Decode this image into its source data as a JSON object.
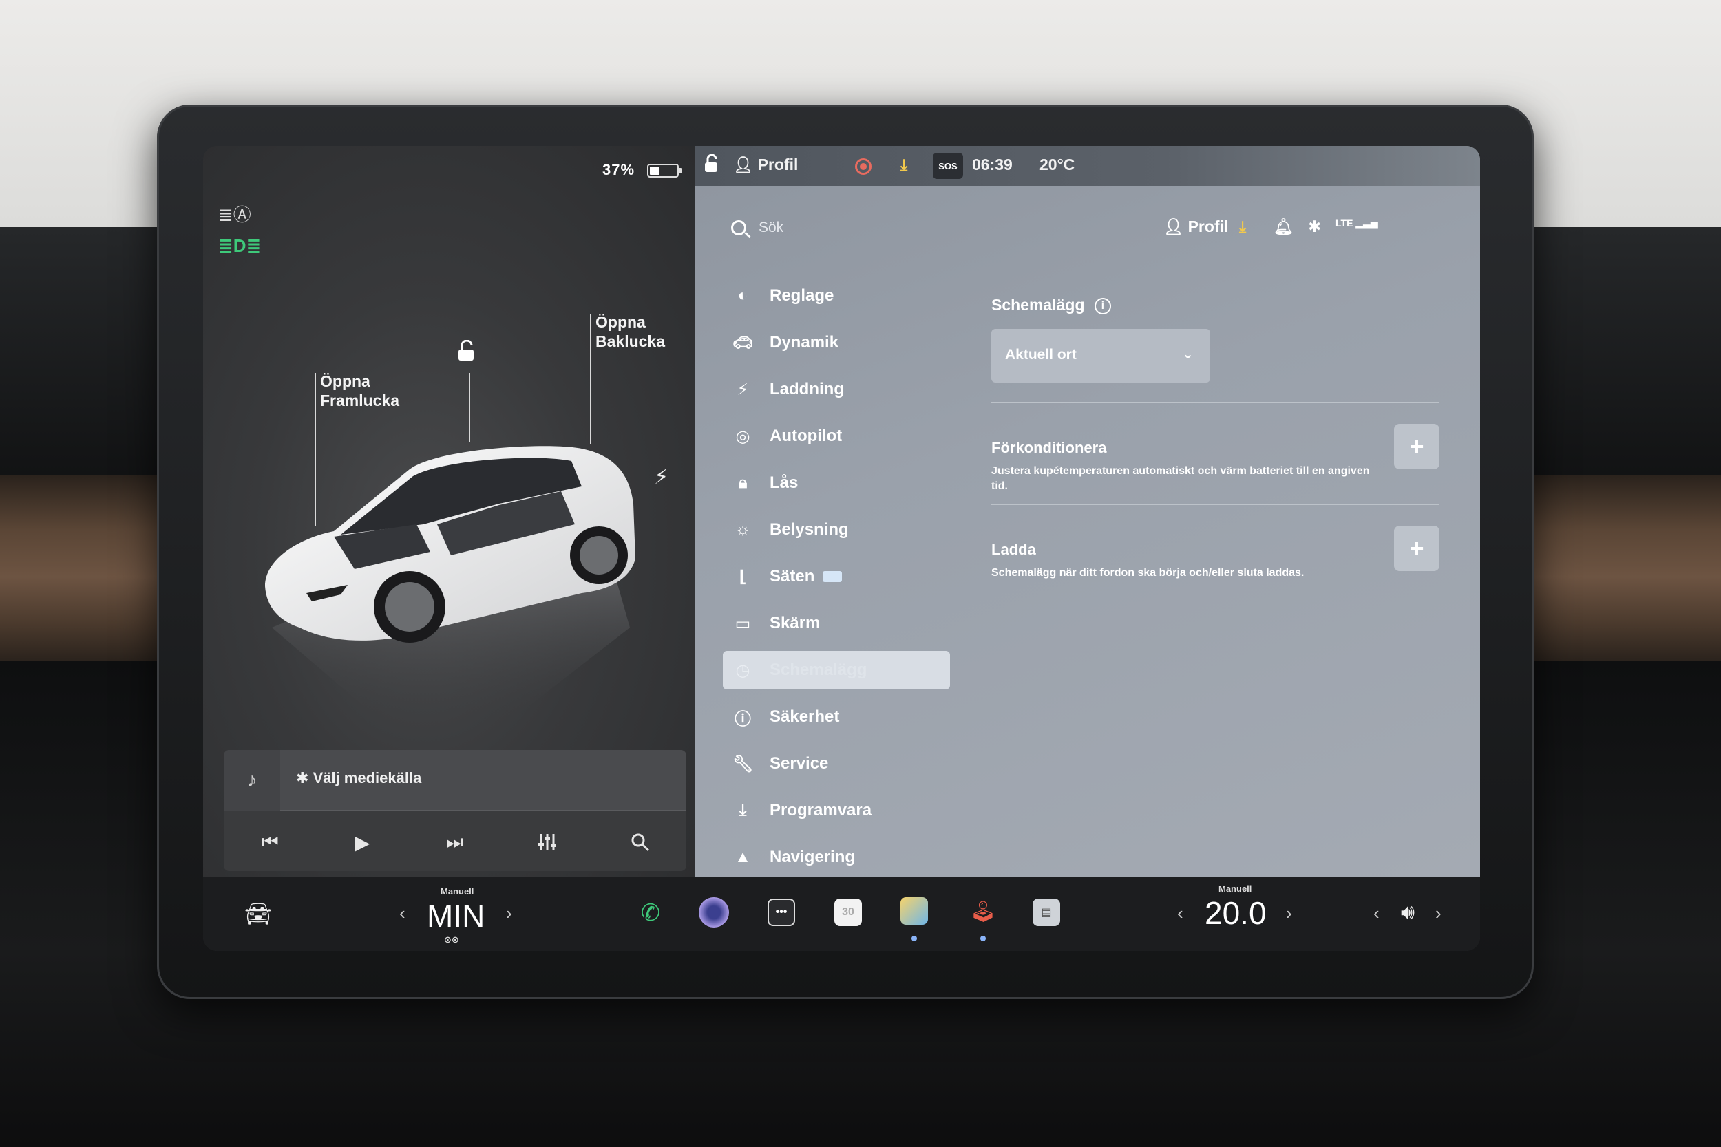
{
  "car_pane": {
    "battery_percent": "37%",
    "battery_level": 0.37,
    "callouts": {
      "front": [
        "Öppna",
        "Framlucka"
      ],
      "rear": [
        "Öppna",
        "Baklucka"
      ]
    },
    "icons": {
      "headlight": "auto-headlight-icon",
      "drl": "drl-icon",
      "lock": "unlock-icon",
      "charge": "lightning-icon"
    }
  },
  "media": {
    "source_label": "Välj mediekälla",
    "bluetooth_glyph": "✱",
    "controls": [
      "previous-track-icon",
      "play-icon",
      "next-track-icon",
      "equalizer-icon",
      "search-icon"
    ]
  },
  "statusbar": {
    "profile": "Profil",
    "time": "06:39",
    "temperature": "20°C",
    "sos": "SOS"
  },
  "search": {
    "placeholder": "Sök",
    "profile": "Profil"
  },
  "menu": {
    "items": [
      {
        "label": "Reglage",
        "icon": "toggle-icon"
      },
      {
        "label": "Dynamik",
        "icon": "car-icon"
      },
      {
        "label": "Laddning",
        "icon": "lightning-icon"
      },
      {
        "label": "Autopilot",
        "icon": "steering-wheel-icon"
      },
      {
        "label": "Lås",
        "icon": "lock-icon"
      },
      {
        "label": "Belysning",
        "icon": "sun-icon"
      },
      {
        "label": "Säten",
        "icon": "seat-icon"
      },
      {
        "label": "Skärm",
        "icon": "display-icon"
      },
      {
        "label": "Schemalägg",
        "icon": "clock-icon",
        "active": true
      },
      {
        "label": "Säkerhet",
        "icon": "info-circle-icon"
      },
      {
        "label": "Service",
        "icon": "wrench-icon"
      },
      {
        "label": "Programvara",
        "icon": "download-icon"
      },
      {
        "label": "Navigering",
        "icon": "navigation-icon"
      }
    ]
  },
  "schedule": {
    "title": "Schemalägg",
    "location_select": "Aktuell ort",
    "precondition": {
      "title": "Förkonditionera",
      "description": "Justera kupétemperaturen automatiskt och värm batteriet till en angiven tid."
    },
    "charge": {
      "title": "Ladda",
      "description": "Schemalägg när ditt fordon ska börja och/eller sluta laddas."
    }
  },
  "bottombar": {
    "left_climate": {
      "mode": "Manuell",
      "value": "MIN"
    },
    "right_climate": {
      "mode": "Manuell",
      "value": "20.0"
    },
    "calendar_day": "30",
    "apps": [
      "phone-icon",
      "camera-icon",
      "more-icon",
      "calendar-icon",
      "photos-icon",
      "joystick-icon",
      "dashcam-icon"
    ]
  },
  "colors": {
    "active_green": "#3ec97a",
    "download_yellow": "#f2c94c",
    "record_red": "#e86b5f"
  }
}
